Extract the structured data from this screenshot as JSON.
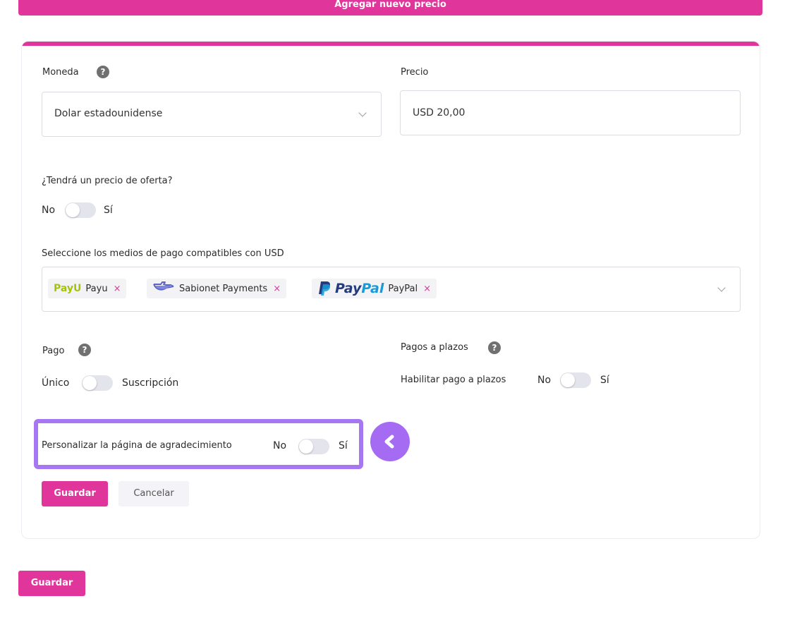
{
  "header": {
    "add_price_label": "Agregar nuevo precio"
  },
  "form": {
    "currency": {
      "label": "Moneda",
      "value": "Dolar estadounidense"
    },
    "price": {
      "label": "Precio",
      "value": "USD 20,00"
    },
    "offer": {
      "question": "¿Tendrá un precio de oferta?",
      "off_label": "No",
      "on_label": "Sí",
      "enabled": false
    },
    "payment_methods": {
      "label": "Seleccione los medios de pago compatibles con USD",
      "items": [
        {
          "logo": "PayU",
          "name": "Payu",
          "remove": "×"
        },
        {
          "logo": "sabionet-logo",
          "name": "Sabionet Payments",
          "remove": "×"
        },
        {
          "logo_pay": "Pay",
          "logo_pal": "Pal",
          "name": "PayPal",
          "remove": "×"
        }
      ]
    },
    "payment": {
      "label": "Pago",
      "off_label": "Único",
      "on_label": "Suscripción",
      "enabled": false
    },
    "installments": {
      "label": "Pagos a plazos",
      "enable_label": "Habilitar pago a plazos",
      "off_label": "No",
      "on_label": "Sí",
      "enabled": false
    },
    "thanks_page": {
      "label": "Personalizar la página de agradecimiento",
      "off_label": "No",
      "on_label": "Sí",
      "enabled": false
    },
    "save_label": "Guardar",
    "cancel_label": "Cancelar"
  },
  "footer": {
    "save_label": "Guardar"
  },
  "colors": {
    "accent": "#e0359b",
    "highlight": "#a777f2",
    "collapse_button": "#a56bf2"
  },
  "icons": {
    "help": "question-circle-icon",
    "dropdown": "chevron-down-icon",
    "collapse": "chevron-left-icon"
  }
}
